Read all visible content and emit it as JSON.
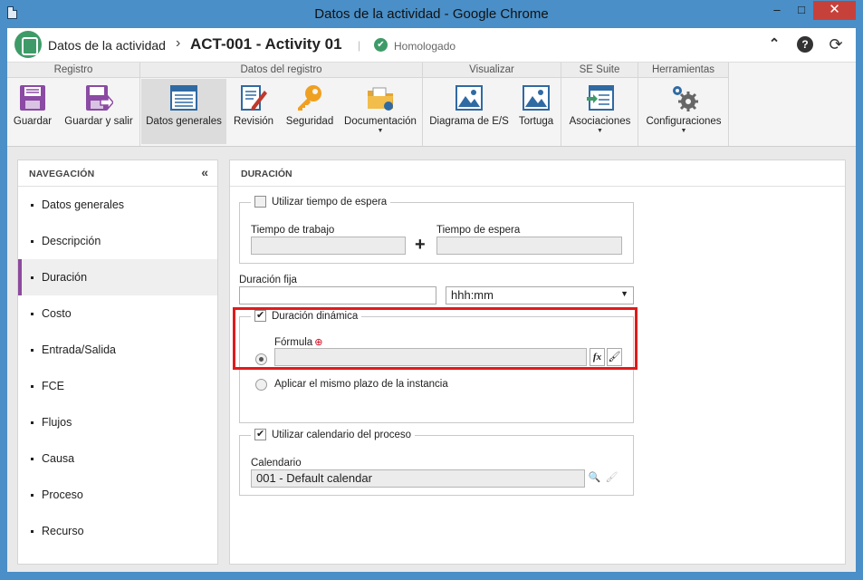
{
  "window": {
    "title": "Datos de la actividad - Google Chrome",
    "minimize_glyph": "–",
    "maximize_glyph": "□",
    "close_glyph": "✕"
  },
  "appbar": {
    "breadcrumb_root": "Datos de la actividad",
    "separator": "›",
    "record_title": "ACT-001 - Activity 01",
    "divider": "|",
    "status_label": "Homologado",
    "status_color": "#3e9b68",
    "controls": {
      "collapse": "⌃",
      "help": "?",
      "refresh": "⟳"
    }
  },
  "ribbon": {
    "groups": [
      {
        "label": "Registro",
        "buttons": [
          {
            "label": "Guardar",
            "icon": "save-icon"
          },
          {
            "label": "Guardar y salir",
            "icon": "save-exit-icon"
          }
        ]
      },
      {
        "label": "Datos del registro",
        "buttons": [
          {
            "label": "Datos generales",
            "icon": "general-data-icon"
          },
          {
            "label": "Revisión",
            "icon": "revision-icon"
          },
          {
            "label": "Seguridad",
            "icon": "key-icon"
          },
          {
            "label": "Documentación",
            "icon": "folder-icon"
          }
        ]
      },
      {
        "label": "Visualizar",
        "buttons": [
          {
            "label": "Diagrama de E/S",
            "icon": "diagram-icon"
          },
          {
            "label": "Tortuga",
            "icon": "turtle-icon"
          }
        ]
      },
      {
        "label": "SE Suite",
        "buttons": [
          {
            "label": "Asociaciones",
            "icon": "associations-icon"
          }
        ]
      },
      {
        "label": "Herramientas",
        "buttons": [
          {
            "label": "Configuraciones",
            "icon": "gears-icon"
          }
        ]
      }
    ],
    "dropdown_caret": "▼"
  },
  "nav": {
    "title": "NAVEGACIÓN",
    "collapse_glyph": "«",
    "items": [
      "Datos generales",
      "Descripción",
      "Duración",
      "Costo",
      "Entrada/Salida",
      "FCE",
      "Flujos",
      "Causa",
      "Proceso",
      "Recurso"
    ],
    "active": "Duración",
    "accent_color": "#8c4a9e"
  },
  "main": {
    "title": "DURACIÓN",
    "wait": {
      "checkbox_label": "Utilizar tiempo de espera",
      "work_time_label": "Tiempo de trabajo",
      "plus": "+",
      "wait_time_label": "Tiempo de espera"
    },
    "fixed": {
      "label": "Duración fija",
      "value": "",
      "unit": "hhh:mm"
    },
    "dynamic": {
      "checkbox_label": "Duración dinámica",
      "formula_label": "Fórmula",
      "required_mark": "⊕",
      "formula_value": "",
      "fx_label": "fx",
      "clear_glyph": "🖌",
      "same_term_label": "Aplicar el mismo plazo de la instancia"
    },
    "calendar": {
      "checkbox_label": "Utilizar calendario del proceso",
      "label": "Calendario",
      "value": "001 - Default calendar",
      "search_glyph": "🔍",
      "clear_glyph": "🖌"
    },
    "highlight_color": "#e01b1b"
  }
}
